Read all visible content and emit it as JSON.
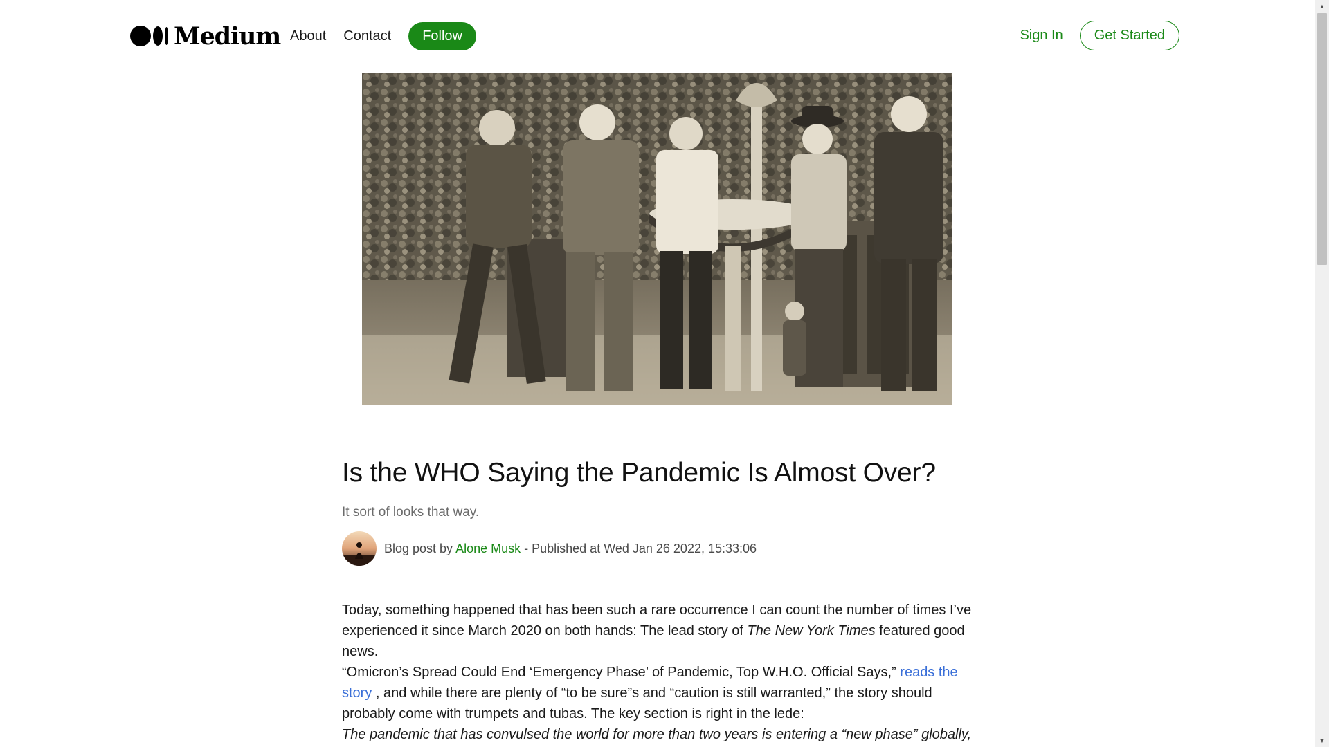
{
  "header": {
    "logo_text": "Medium",
    "nav": {
      "about": "About",
      "contact": "Contact",
      "follow": "Follow"
    },
    "sign_in": "Sign In",
    "get_started": "Get Started"
  },
  "hero": {
    "icon": "historical-photo",
    "alt": "Men wearing masks around a drinking fountain, 1918"
  },
  "article": {
    "title": "Is the WHO Saying the Pandemic Is Almost Over?",
    "subtitle": "It sort of looks that way.",
    "byline": {
      "prefix": "Blog post by ",
      "author": "Alone Musk",
      "published": " - Published at Wed Jan 26 2022, 15:33:06"
    },
    "body": {
      "p1_start": "Today, something happened that has been such a rare occurrence I can count the number of times I’ve experienced it since March 2020 on both hands: The lead story of ",
      "p1_italic": "The New York Times",
      "p1_end": " featured good news.",
      "p2_start": "“Omicron’s Spread Could End ‘Emergency Phase’ of Pandemic, Top W.H.O. Official Says,” ",
      "p2_link": "reads the story",
      "p2_end": " , and while there are plenty of “to be sure”s and “caution is still warranted,” the story should probably come with trumpets and tubas. The key section is right in the lede:",
      "p3_italic": "The pandemic that has convulsed the world for more than two years is entering a “new phase” globally, and the rapid spread of the Omicron variant of the coronavirus offers “plausible hope” for"
    }
  },
  "colors": {
    "brand_green": "#1a8917",
    "link_blue": "#3a6fd8",
    "text": "#1a1a1a",
    "muted": "#6b6b6b"
  }
}
